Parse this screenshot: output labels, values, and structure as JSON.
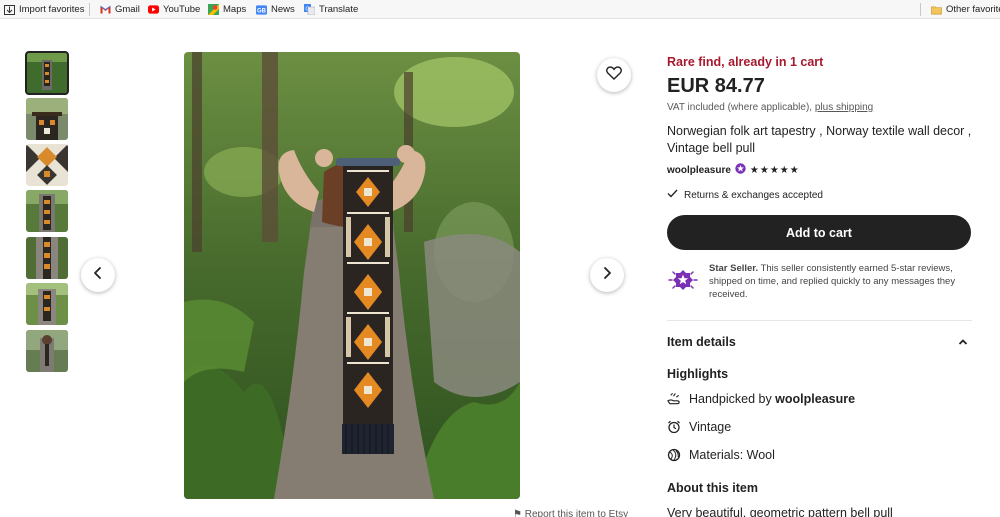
{
  "bookmarks": {
    "items": [
      {
        "label": "Import favorites",
        "icon": "import-icon"
      },
      {
        "label": "Gmail",
        "icon": "gmail-icon"
      },
      {
        "label": "YouTube",
        "icon": "youtube-icon"
      },
      {
        "label": "Maps",
        "icon": "maps-icon"
      },
      {
        "label": "News",
        "icon": "news-icon"
      },
      {
        "label": "Translate",
        "icon": "translate-icon"
      }
    ],
    "other": "Other favorites"
  },
  "gallery": {
    "thumbnail_count": 7,
    "selected_index": 0,
    "report_text": "Report this item to Etsy"
  },
  "product": {
    "rare": "Rare find, already in 1 cart",
    "price": "EUR 84.77",
    "vat_text": "VAT included (where applicable), ",
    "shipping_link": "plus shipping",
    "title": "Norwegian folk art tapestry , Norway textile wall decor , Vintage bell pull",
    "seller": "woolpleasure",
    "rating": "★★★★★",
    "returns": "Returns & exchanges accepted",
    "add_to_cart": "Add to cart",
    "star_seller_title": "Star Seller.",
    "star_seller_text": " This seller consistently earned 5-star reviews, shipped on time, and replied quickly to any messages they received."
  },
  "details": {
    "heading": "Item details",
    "highlights_heading": "Highlights",
    "handpicked_prefix": "Handpicked by ",
    "handpicked_seller": "woolpleasure",
    "vintage": "Vintage",
    "materials": "Materials: Wool",
    "about_heading": "About this item",
    "description": "Very beautiful, geometric pattern bell pull"
  },
  "colors": {
    "accent_red": "#a61a2e",
    "button_bg": "#222222",
    "star_seller_purple": "#7b2fb5"
  }
}
